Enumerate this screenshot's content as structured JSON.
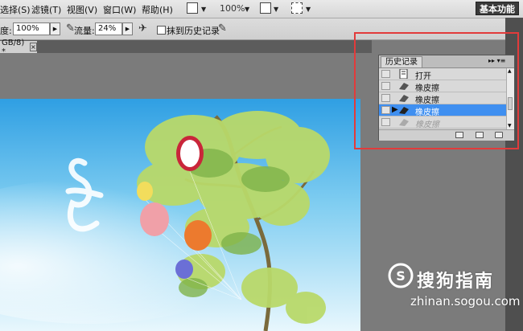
{
  "menubar": {
    "items": [
      {
        "id": "select",
        "label": "选择(S)"
      },
      {
        "id": "filter",
        "label": "滤镜(T)"
      },
      {
        "id": "view",
        "label": "视图(V)"
      },
      {
        "id": "window",
        "label": "窗口(W)"
      },
      {
        "id": "help",
        "label": "帮助(H)"
      }
    ],
    "zoom_label": "100%",
    "workspace_label": "基本功能"
  },
  "options_bar": {
    "opacity_label": "度:",
    "opacity_value": "100%",
    "flow_label": "流量:",
    "flow_value": "24%",
    "erase_history_label": "抹到历史记录"
  },
  "document_tab": {
    "label": "GB/8) *",
    "close": "×"
  },
  "history_panel": {
    "title": "历史记录",
    "menu_glyph": "▸▸ ▾≡",
    "items": [
      {
        "label": "打开",
        "icon": "open-document-icon",
        "state": "normal"
      },
      {
        "label": "橡皮擦",
        "icon": "eraser-icon",
        "state": "normal"
      },
      {
        "label": "橡皮擦",
        "icon": "eraser-icon",
        "state": "normal"
      },
      {
        "label": "橡皮擦",
        "icon": "eraser-icon",
        "state": "selected"
      },
      {
        "label": "橡皮擦",
        "icon": "eraser-icon",
        "state": "undone"
      }
    ]
  },
  "watermark": {
    "brand": "搜狗指南",
    "url": "zhinan.sogou.com"
  },
  "colors": {
    "selection": "#3f8ff0",
    "highlight_box": "#e23b3b"
  }
}
